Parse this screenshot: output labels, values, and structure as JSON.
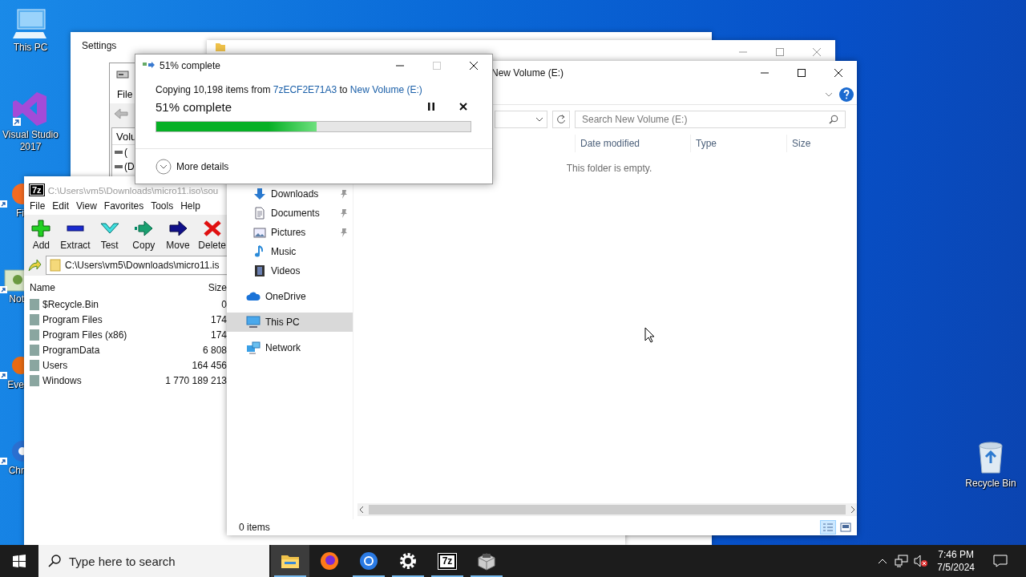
{
  "desktop": {
    "icons": [
      {
        "label": "This PC",
        "kind": "pc"
      },
      {
        "label": "Visual Studio 2017",
        "kind": "vs"
      }
    ],
    "covered_icons": [
      {
        "label": "Fi",
        "kind": "firefox"
      },
      {
        "label": "Not",
        "kind": "notepad"
      },
      {
        "label": "Eve",
        "kind": "app"
      },
      {
        "label": "Chr",
        "kind": "chrome"
      }
    ],
    "recycle_bin": {
      "label": "Recycle Bin"
    }
  },
  "settings_window": {
    "title": "Settings"
  },
  "volume_window": {
    "menu": [
      "File"
    ],
    "column": "Volu",
    "rows": [
      "(",
      "(D"
    ]
  },
  "archive_window": {
    "icon_text": "7z",
    "title": "C:\\Users\\vm5\\Downloads\\micro11.iso\\sou",
    "menu": [
      "File",
      "Edit",
      "View",
      "Favorites",
      "Tools",
      "Help"
    ],
    "toolbar": [
      {
        "label": "Add",
        "kind": "add"
      },
      {
        "label": "Extract",
        "kind": "extract"
      },
      {
        "label": "Test",
        "kind": "test"
      },
      {
        "label": "Copy",
        "kind": "copy"
      },
      {
        "label": "Move",
        "kind": "move"
      },
      {
        "label": "Delete",
        "kind": "delete"
      }
    ],
    "path": "C:\\Users\\vm5\\Downloads\\micro11.is",
    "columns": [
      "Name",
      "Size"
    ],
    "rows": [
      {
        "name": "$Recycle.Bin",
        "size": "0"
      },
      {
        "name": "Program Files",
        "size": "174"
      },
      {
        "name": "Program Files (x86)",
        "size": "174"
      },
      {
        "name": "ProgramData",
        "size": "6 808"
      },
      {
        "name": "Users",
        "size": "164 456"
      },
      {
        "name": "Windows",
        "size": "1 770 189 213"
      }
    ]
  },
  "explorer": {
    "title": "New Volume (E:)",
    "search": {
      "placeholder": "Search New Volume (E:)"
    },
    "quick_access": [
      {
        "label": "Downloads",
        "kind": "downloads",
        "pinned": true
      },
      {
        "label": "Documents",
        "kind": "documents",
        "pinned": true
      },
      {
        "label": "Pictures",
        "kind": "pictures",
        "pinned": true
      },
      {
        "label": "Music",
        "kind": "music",
        "pinned": false
      },
      {
        "label": "Videos",
        "kind": "videos",
        "pinned": false
      }
    ],
    "locations": [
      {
        "label": "OneDrive",
        "kind": "cloud",
        "selected": false
      },
      {
        "label": "This PC",
        "kind": "pc",
        "selected": true
      },
      {
        "label": "Network",
        "kind": "network",
        "selected": false
      }
    ],
    "columns": [
      "Date modified",
      "Type",
      "Size"
    ],
    "empty_message": "This folder is empty.",
    "status": "0 items"
  },
  "copy_dialog": {
    "title": "51% complete",
    "text": "Copying 10,198 items from",
    "source": "7zECF2E71A3",
    "joiner": "to",
    "destination": "New Volume (E:)",
    "heading": "51% complete",
    "level": 0.51,
    "more": "More details"
  },
  "taskbar": {
    "search": {
      "placeholder": "Type here to search"
    },
    "apps": [
      {
        "kind": "explorer",
        "active": true,
        "running": true
      },
      {
        "kind": "firefox",
        "active": false,
        "running": false
      },
      {
        "kind": "chrome",
        "active": false,
        "running": true
      },
      {
        "kind": "settings",
        "active": false,
        "running": true
      },
      {
        "kind": "sevenzip",
        "label": "7z",
        "active": false,
        "running": true
      },
      {
        "kind": "installer",
        "active": false,
        "running": true
      }
    ],
    "time": "7:46 PM",
    "date": "7/5/2024"
  }
}
